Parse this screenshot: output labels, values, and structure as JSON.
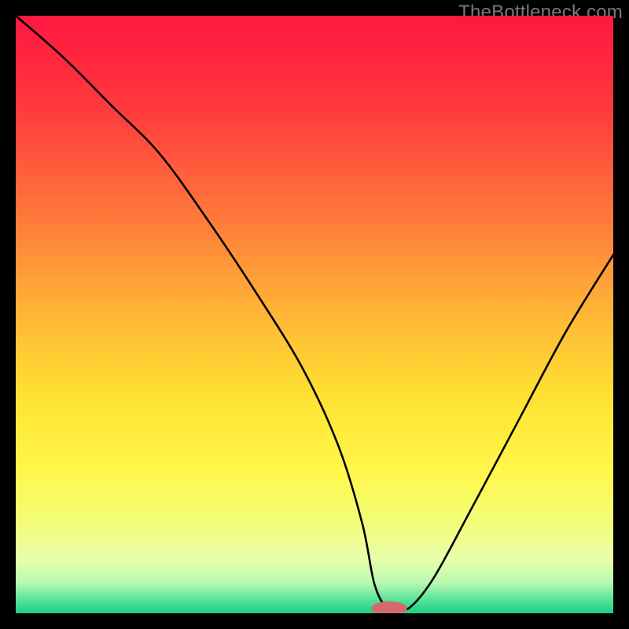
{
  "watermark": "TheBottleneck.com",
  "chart_data": {
    "type": "line",
    "title": "",
    "xlabel": "",
    "ylabel": "",
    "xlim": [
      0,
      100
    ],
    "ylim": [
      0,
      100
    ],
    "series": [
      {
        "name": "bottleneck-curve",
        "x": [
          0,
          8,
          16,
          24,
          32,
          40,
          48,
          54,
          58,
          60,
          62,
          64,
          66,
          70,
          76,
          84,
          92,
          100
        ],
        "values": [
          100,
          93,
          85,
          77,
          66,
          54,
          41,
          28,
          15,
          5,
          1,
          1,
          1,
          6,
          17,
          32,
          47,
          60
        ]
      }
    ],
    "marker": {
      "x": 62.5,
      "y": 0.8,
      "rx": 3.0,
      "ry": 1.2,
      "color": "#d46a6a"
    },
    "background_gradient": {
      "stops": [
        {
          "pos": 0.0,
          "color": "#ff173f"
        },
        {
          "pos": 0.16,
          "color": "#ff3b3e"
        },
        {
          "pos": 0.34,
          "color": "#ff7a3a"
        },
        {
          "pos": 0.5,
          "color": "#ffb636"
        },
        {
          "pos": 0.64,
          "color": "#ffe233"
        },
        {
          "pos": 0.76,
          "color": "#fff74a"
        },
        {
          "pos": 0.85,
          "color": "#f3fd7a"
        },
        {
          "pos": 0.91,
          "color": "#e8ffab"
        },
        {
          "pos": 0.95,
          "color": "#b6f9b0"
        },
        {
          "pos": 0.975,
          "color": "#5ee59a"
        },
        {
          "pos": 1.0,
          "color": "#17d184"
        }
      ]
    }
  }
}
